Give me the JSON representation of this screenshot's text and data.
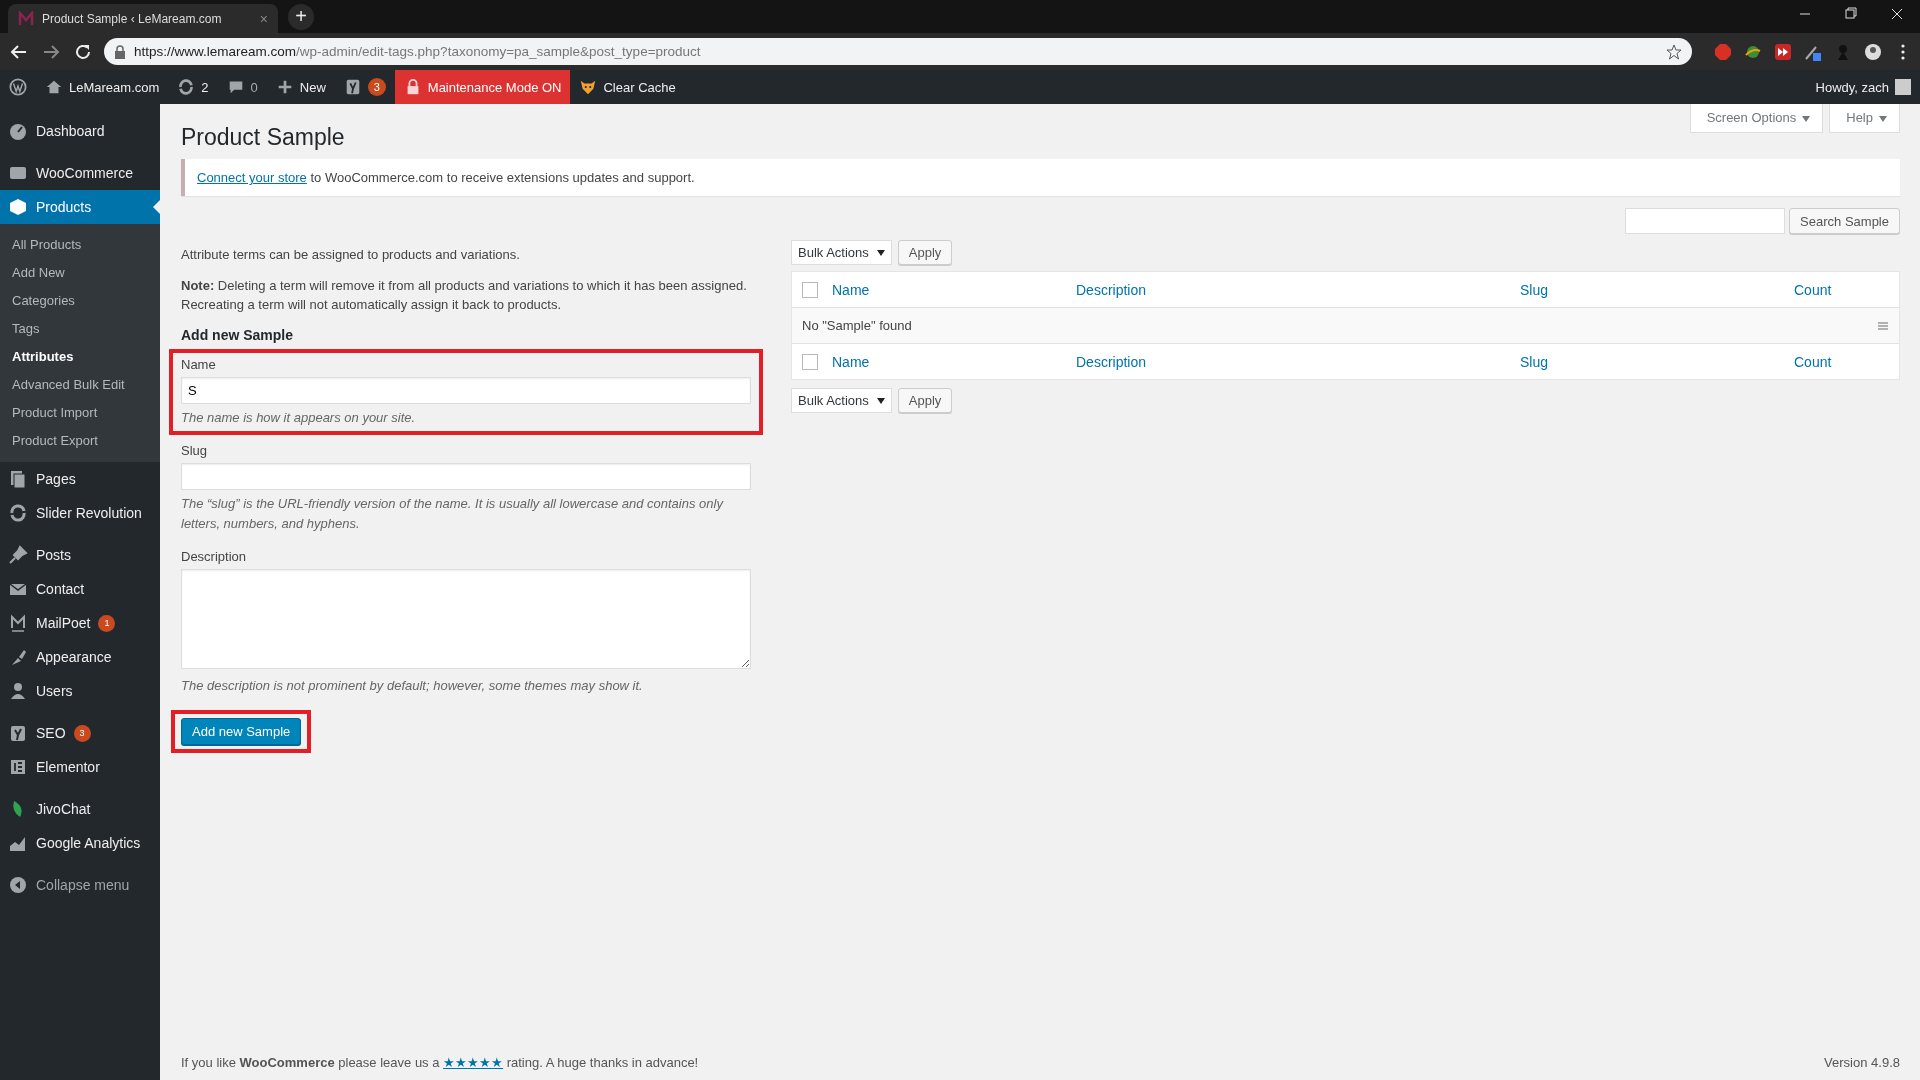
{
  "browser": {
    "tab_title": "Product Sample ‹ LeMaream.com",
    "tab_close": "×",
    "new_tab": "+",
    "url_origin": "https://www.lemaream.com",
    "url_path": "/wp-admin/edit-tags.php?taxonomy=pa_sample&post_type=product"
  },
  "admin_bar": {
    "site": "LeMaream.com",
    "updates": "2",
    "comments": "0",
    "new": "New",
    "seo_count": "3",
    "maintenance": "Maintenance Mode ON",
    "cache": "Clear Cache",
    "howdy": "Howdy, zach"
  },
  "sidebar": {
    "groups": [
      [
        {
          "label": "Dashboard",
          "selected": false
        }
      ],
      [
        {
          "label": "WooCommerce",
          "selected": false
        },
        {
          "label": "Products",
          "selected": true,
          "children": [
            {
              "label": "All Products",
              "selected": false
            },
            {
              "label": "Add New",
              "selected": false
            },
            {
              "label": "Categories",
              "selected": false
            },
            {
              "label": "Tags",
              "selected": false
            },
            {
              "label": "Attributes",
              "selected": true
            },
            {
              "label": "Advanced Bulk Edit",
              "selected": false
            },
            {
              "label": "Product Import",
              "selected": false
            },
            {
              "label": "Product Export",
              "selected": false
            }
          ]
        },
        {
          "label": "Pages",
          "selected": false
        },
        {
          "label": "Slider Revolution",
          "selected": false
        }
      ],
      [
        {
          "label": "Posts",
          "selected": false
        },
        {
          "label": "Contact",
          "selected": false
        },
        {
          "label": "MailPoet",
          "selected": false,
          "badge": "1"
        },
        {
          "label": "Appearance",
          "selected": false
        },
        {
          "label": "Users",
          "selected": false
        }
      ],
      [
        {
          "label": "SEO",
          "selected": false,
          "badge": "3"
        },
        {
          "label": "Elementor",
          "selected": false
        }
      ],
      [
        {
          "label": "JivoChat",
          "selected": false
        },
        {
          "label": "Google Analytics",
          "selected": false
        }
      ]
    ],
    "collapse": "Collapse menu"
  },
  "page": {
    "title": "Product Sample",
    "screen_options": "Screen Options",
    "help": "Help",
    "notice": {
      "link": "Connect your store",
      "text": "to WooCommerce.com to receive extensions updates and support."
    }
  },
  "form": {
    "intro": "Attribute terms can be assigned to products and variations.",
    "note": "**Note:** Deleting a term will remove it from all products and variations to which it has been assigned. Recreating a term will not automatically assign it back to products.",
    "heading": "Add new Sample",
    "fields": [
      {
        "kind": "input",
        "label": "Name",
        "value": "S",
        "hint": "The name is how it appears on your site.",
        "highlighted": true
      },
      {
        "kind": "input",
        "label": "Slug",
        "hint": "The “slug” is the URL-friendly version of the name. It is usually all lowercase and contains only letters, numbers, and hyphens.",
        "highlighted": false
      },
      {
        "kind": "textarea",
        "label": "Description",
        "hint": "The description is not prominent by default; however, some themes may show it.",
        "highlighted": false
      }
    ],
    "submit": {
      "label": "Add new Sample",
      "highlighted": true
    }
  },
  "table": {
    "search_button": "Search Sample",
    "top_bulk": "Bulk Actions",
    "top_apply": "Apply",
    "header_checked": false,
    "header_columns": [
      "Name",
      "Description",
      "Slug",
      "Count"
    ],
    "empty": "No \"Sample\" found",
    "footer_checked": false,
    "footer_columns": [
      "Name",
      "Description",
      "Slug",
      "Count"
    ],
    "bottom_bulk": "Bulk Actions",
    "bottom_apply": "Apply"
  },
  "footer": {
    "before": "If you like **WooCommerce** please leave us a",
    "link": "★★★★★",
    "after": "rating. A huge thanks in advance!",
    "version": "Version 4.9.8"
  }
}
